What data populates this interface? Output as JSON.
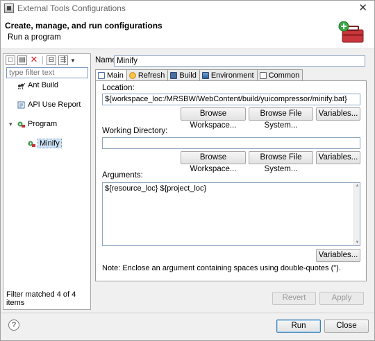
{
  "window": {
    "title": "External Tools Configurations",
    "close_glyph": "✕"
  },
  "header": {
    "title": "Create, manage, and run configurations",
    "subtitle": "Run a program"
  },
  "left": {
    "filter_placeholder": "type filter text",
    "tree": [
      {
        "label": "Ant Build",
        "icon": "ant-icon",
        "level": 1
      },
      {
        "label": "API Use Report",
        "icon": "api-report-icon",
        "level": 1
      },
      {
        "label": "Program",
        "icon": "program-icon",
        "level": 0,
        "expanded": true
      },
      {
        "label": "Minify",
        "icon": "program-config-icon",
        "level": 2,
        "selected": true
      }
    ],
    "status": "Filter matched 4 of 4 items"
  },
  "name": {
    "label": "Name:",
    "value": "Minify"
  },
  "tabs": [
    {
      "label": "Main",
      "icon": "main-tab-icon",
      "active": true
    },
    {
      "label": "Refresh",
      "icon": "refresh-icon"
    },
    {
      "label": "Build",
      "icon": "build-icon"
    },
    {
      "label": "Environment",
      "icon": "environment-icon"
    },
    {
      "label": "Common",
      "icon": "common-icon"
    }
  ],
  "main": {
    "location_label": "Location:",
    "location_value": "${workspace_loc:/MRSBW/WebContent/build/yuicompressor/minify.bat}",
    "workdir_label": "Working Directory:",
    "workdir_value": "",
    "browse_workspace": "Browse Workspace...",
    "browse_filesystem": "Browse File System...",
    "variables": "Variables...",
    "arguments_label": "Arguments:",
    "arguments_value": "${resource_loc} ${project_loc}",
    "note": "Note: Enclose an argument containing spaces using double-quotes (\")."
  },
  "actions": {
    "revert": "Revert",
    "apply": "Apply",
    "run": "Run",
    "close": "Close",
    "help": "?"
  }
}
